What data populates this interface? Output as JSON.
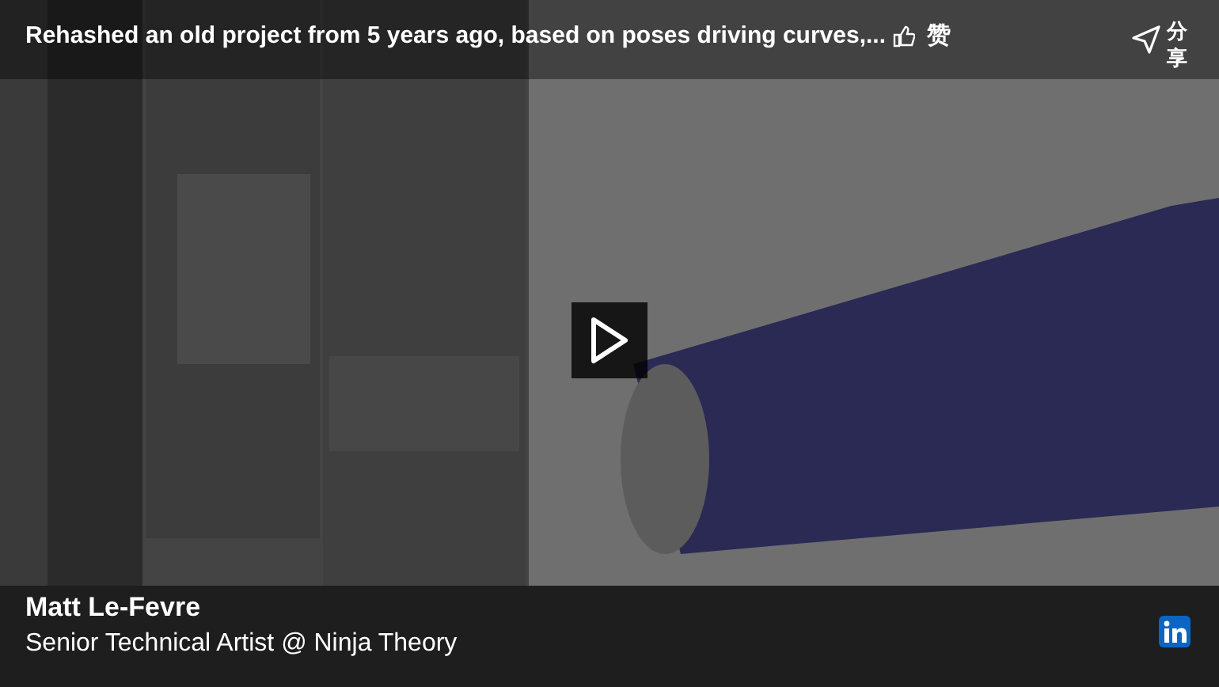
{
  "title": "Rehashed an old project from 5 years ago, based on poses driving curves,...",
  "like_label": "赞",
  "share_label": "分享",
  "author": {
    "name": "Matt Le-Fevre",
    "headline": "Senior Technical Artist @ Ninja Theory"
  }
}
